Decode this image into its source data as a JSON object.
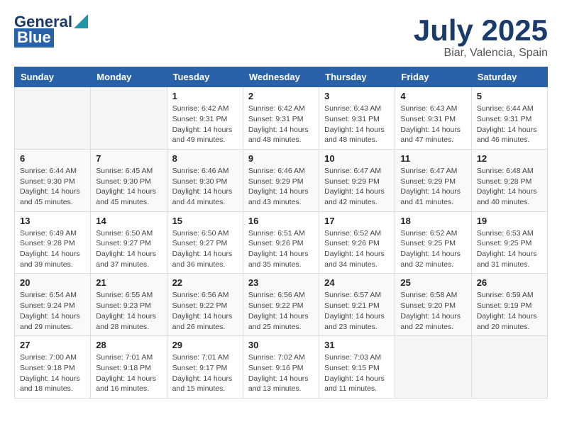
{
  "header": {
    "logo_general": "General",
    "logo_blue": "Blue",
    "title": "July 2025",
    "subtitle": "Biar, Valencia, Spain"
  },
  "weekdays": [
    "Sunday",
    "Monday",
    "Tuesday",
    "Wednesday",
    "Thursday",
    "Friday",
    "Saturday"
  ],
  "weeks": [
    [
      {
        "day": "",
        "sunrise": "",
        "sunset": "",
        "daylight": ""
      },
      {
        "day": "",
        "sunrise": "",
        "sunset": "",
        "daylight": ""
      },
      {
        "day": "1",
        "sunrise": "Sunrise: 6:42 AM",
        "sunset": "Sunset: 9:31 PM",
        "daylight": "Daylight: 14 hours and 49 minutes."
      },
      {
        "day": "2",
        "sunrise": "Sunrise: 6:42 AM",
        "sunset": "Sunset: 9:31 PM",
        "daylight": "Daylight: 14 hours and 48 minutes."
      },
      {
        "day": "3",
        "sunrise": "Sunrise: 6:43 AM",
        "sunset": "Sunset: 9:31 PM",
        "daylight": "Daylight: 14 hours and 48 minutes."
      },
      {
        "day": "4",
        "sunrise": "Sunrise: 6:43 AM",
        "sunset": "Sunset: 9:31 PM",
        "daylight": "Daylight: 14 hours and 47 minutes."
      },
      {
        "day": "5",
        "sunrise": "Sunrise: 6:44 AM",
        "sunset": "Sunset: 9:31 PM",
        "daylight": "Daylight: 14 hours and 46 minutes."
      }
    ],
    [
      {
        "day": "6",
        "sunrise": "Sunrise: 6:44 AM",
        "sunset": "Sunset: 9:30 PM",
        "daylight": "Daylight: 14 hours and 45 minutes."
      },
      {
        "day": "7",
        "sunrise": "Sunrise: 6:45 AM",
        "sunset": "Sunset: 9:30 PM",
        "daylight": "Daylight: 14 hours and 45 minutes."
      },
      {
        "day": "8",
        "sunrise": "Sunrise: 6:46 AM",
        "sunset": "Sunset: 9:30 PM",
        "daylight": "Daylight: 14 hours and 44 minutes."
      },
      {
        "day": "9",
        "sunrise": "Sunrise: 6:46 AM",
        "sunset": "Sunset: 9:29 PM",
        "daylight": "Daylight: 14 hours and 43 minutes."
      },
      {
        "day": "10",
        "sunrise": "Sunrise: 6:47 AM",
        "sunset": "Sunset: 9:29 PM",
        "daylight": "Daylight: 14 hours and 42 minutes."
      },
      {
        "day": "11",
        "sunrise": "Sunrise: 6:47 AM",
        "sunset": "Sunset: 9:29 PM",
        "daylight": "Daylight: 14 hours and 41 minutes."
      },
      {
        "day": "12",
        "sunrise": "Sunrise: 6:48 AM",
        "sunset": "Sunset: 9:28 PM",
        "daylight": "Daylight: 14 hours and 40 minutes."
      }
    ],
    [
      {
        "day": "13",
        "sunrise": "Sunrise: 6:49 AM",
        "sunset": "Sunset: 9:28 PM",
        "daylight": "Daylight: 14 hours and 39 minutes."
      },
      {
        "day": "14",
        "sunrise": "Sunrise: 6:50 AM",
        "sunset": "Sunset: 9:27 PM",
        "daylight": "Daylight: 14 hours and 37 minutes."
      },
      {
        "day": "15",
        "sunrise": "Sunrise: 6:50 AM",
        "sunset": "Sunset: 9:27 PM",
        "daylight": "Daylight: 14 hours and 36 minutes."
      },
      {
        "day": "16",
        "sunrise": "Sunrise: 6:51 AM",
        "sunset": "Sunset: 9:26 PM",
        "daylight": "Daylight: 14 hours and 35 minutes."
      },
      {
        "day": "17",
        "sunrise": "Sunrise: 6:52 AM",
        "sunset": "Sunset: 9:26 PM",
        "daylight": "Daylight: 14 hours and 34 minutes."
      },
      {
        "day": "18",
        "sunrise": "Sunrise: 6:52 AM",
        "sunset": "Sunset: 9:25 PM",
        "daylight": "Daylight: 14 hours and 32 minutes."
      },
      {
        "day": "19",
        "sunrise": "Sunrise: 6:53 AM",
        "sunset": "Sunset: 9:25 PM",
        "daylight": "Daylight: 14 hours and 31 minutes."
      }
    ],
    [
      {
        "day": "20",
        "sunrise": "Sunrise: 6:54 AM",
        "sunset": "Sunset: 9:24 PM",
        "daylight": "Daylight: 14 hours and 29 minutes."
      },
      {
        "day": "21",
        "sunrise": "Sunrise: 6:55 AM",
        "sunset": "Sunset: 9:23 PM",
        "daylight": "Daylight: 14 hours and 28 minutes."
      },
      {
        "day": "22",
        "sunrise": "Sunrise: 6:56 AM",
        "sunset": "Sunset: 9:22 PM",
        "daylight": "Daylight: 14 hours and 26 minutes."
      },
      {
        "day": "23",
        "sunrise": "Sunrise: 6:56 AM",
        "sunset": "Sunset: 9:22 PM",
        "daylight": "Daylight: 14 hours and 25 minutes."
      },
      {
        "day": "24",
        "sunrise": "Sunrise: 6:57 AM",
        "sunset": "Sunset: 9:21 PM",
        "daylight": "Daylight: 14 hours and 23 minutes."
      },
      {
        "day": "25",
        "sunrise": "Sunrise: 6:58 AM",
        "sunset": "Sunset: 9:20 PM",
        "daylight": "Daylight: 14 hours and 22 minutes."
      },
      {
        "day": "26",
        "sunrise": "Sunrise: 6:59 AM",
        "sunset": "Sunset: 9:19 PM",
        "daylight": "Daylight: 14 hours and 20 minutes."
      }
    ],
    [
      {
        "day": "27",
        "sunrise": "Sunrise: 7:00 AM",
        "sunset": "Sunset: 9:18 PM",
        "daylight": "Daylight: 14 hours and 18 minutes."
      },
      {
        "day": "28",
        "sunrise": "Sunrise: 7:01 AM",
        "sunset": "Sunset: 9:18 PM",
        "daylight": "Daylight: 14 hours and 16 minutes."
      },
      {
        "day": "29",
        "sunrise": "Sunrise: 7:01 AM",
        "sunset": "Sunset: 9:17 PM",
        "daylight": "Daylight: 14 hours and 15 minutes."
      },
      {
        "day": "30",
        "sunrise": "Sunrise: 7:02 AM",
        "sunset": "Sunset: 9:16 PM",
        "daylight": "Daylight: 14 hours and 13 minutes."
      },
      {
        "day": "31",
        "sunrise": "Sunrise: 7:03 AM",
        "sunset": "Sunset: 9:15 PM",
        "daylight": "Daylight: 14 hours and 11 minutes."
      },
      {
        "day": "",
        "sunrise": "",
        "sunset": "",
        "daylight": ""
      },
      {
        "day": "",
        "sunrise": "",
        "sunset": "",
        "daylight": ""
      }
    ]
  ]
}
